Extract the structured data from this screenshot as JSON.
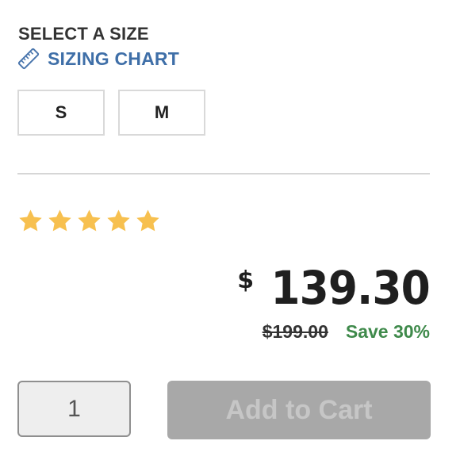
{
  "size_selector": {
    "heading": "SELECT A SIZE",
    "sizing_chart_link": "SIZING CHART",
    "sizing_chart_icon": "ruler-icon",
    "options": [
      "S",
      "M"
    ]
  },
  "rating": {
    "stars": 5,
    "max": 5,
    "star_color": "#f7c04f"
  },
  "pricing": {
    "currency_symbol": "$",
    "price": "139.30",
    "original_price": "$199.00",
    "savings": "Save 30%",
    "savings_color": "#3f8a4b"
  },
  "purchase": {
    "quantity": "1",
    "add_to_cart_label": "Add to Cart"
  },
  "colors": {
    "link": "#3f6fa8",
    "button_disabled_bg": "#a8a8a8",
    "button_disabled_text": "#c6c6c6"
  }
}
